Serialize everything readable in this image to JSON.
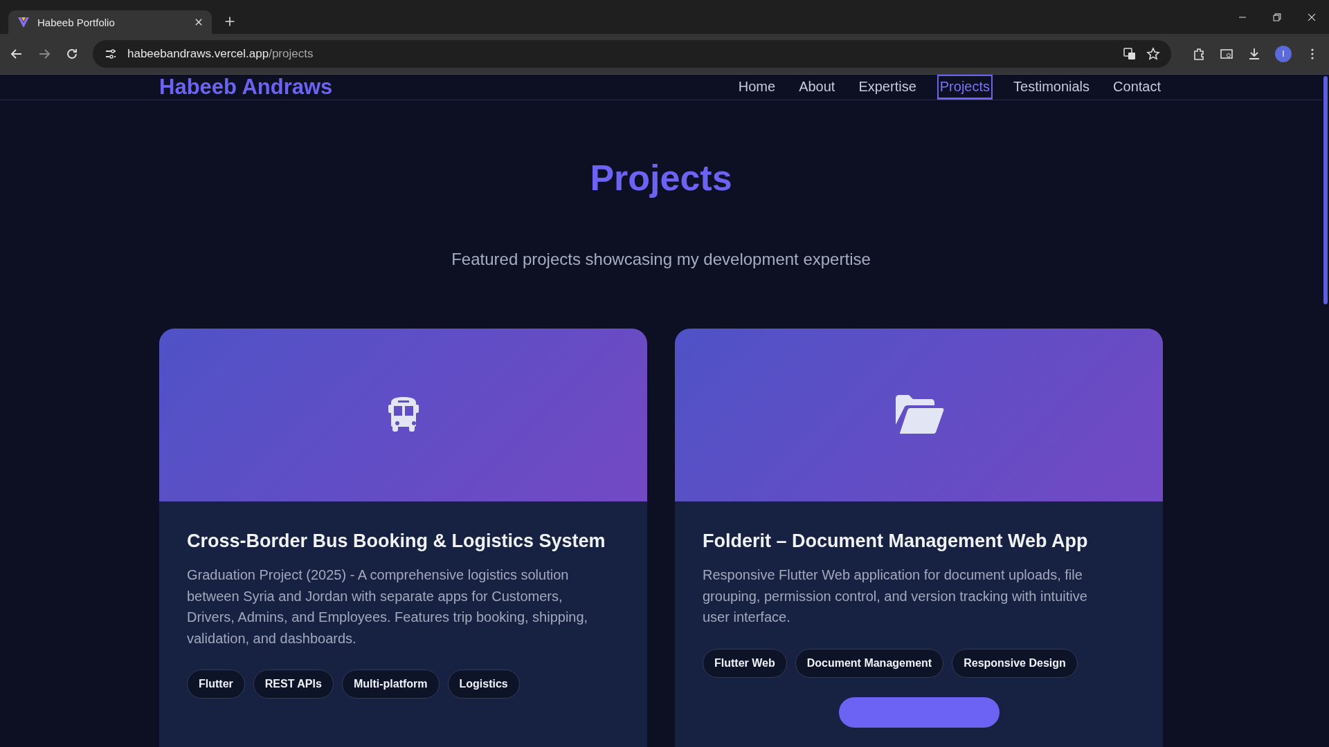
{
  "browser": {
    "tab_title": "Habeeb Portfolio",
    "url_host": "habeebandraws.vercel.app",
    "url_path": "/projects",
    "avatar_letter": "I"
  },
  "nav": {
    "brand": "Habeeb Andraws",
    "items": [
      {
        "label": "Home",
        "selected": false
      },
      {
        "label": "About",
        "selected": false
      },
      {
        "label": "Expertise",
        "selected": false
      },
      {
        "label": "Projects",
        "selected": true
      },
      {
        "label": "Testimonials",
        "selected": false
      },
      {
        "label": "Contact",
        "selected": false
      }
    ]
  },
  "heading": "Projects",
  "subtitle": "Featured projects showcasing my development expertise",
  "projects": [
    {
      "kind": "bus",
      "title": "Cross-Border Bus Booking & Logistics System",
      "description": "Graduation Project (2025) - A comprehensive logistics solution between Syria and Jordan with separate apps for Customers, Drivers, Admins, and Employees. Features trip booking, shipping, validation, and dashboards.",
      "tags": [
        "Flutter",
        "REST APIs",
        "Multi-platform",
        "Logistics"
      ],
      "has_button": false
    },
    {
      "kind": "folder",
      "title": "Folderit – Document Management Web App",
      "description": "Responsive Flutter Web application for document uploads, file grouping, permission control, and version tracking with intuitive user interface.",
      "tags": [
        "Flutter Web",
        "Document Management",
        "Responsive Design"
      ],
      "has_button": true
    }
  ]
}
